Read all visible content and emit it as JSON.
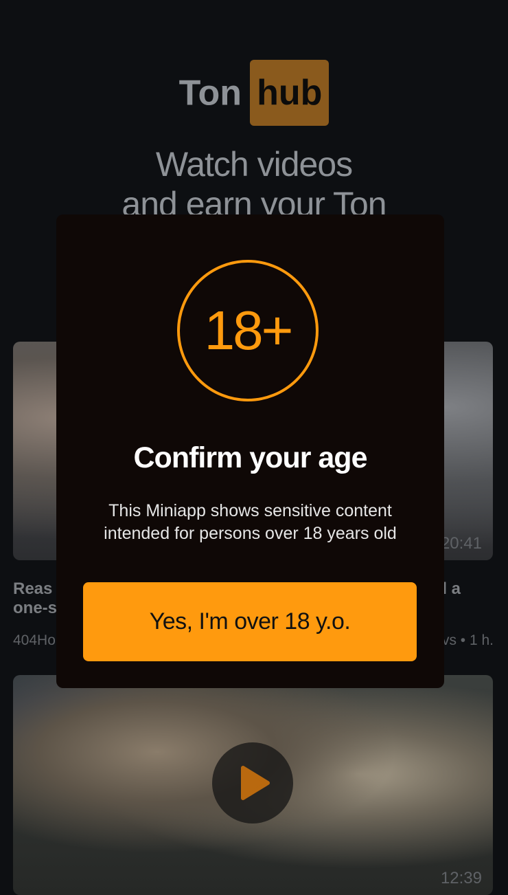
{
  "brand": {
    "logo_part1": "Ton",
    "logo_part2": "hub",
    "accent_color": "#ff9a0e"
  },
  "headline": {
    "line1": "Watch videos",
    "line2": "and earn your Ton"
  },
  "videos": [
    {
      "title_left_line1": "Reas",
      "title_left_line2": "one-s",
      "title_right": "l a",
      "meta_left": "404Ho",
      "meta_right": "vs • 1 h.",
      "duration": "20:41"
    },
    {
      "duration": "12:39",
      "play_icon": "play-icon"
    }
  ],
  "modal": {
    "age_badge": "18+",
    "title": "Confirm your age",
    "description": "This Miniapp shows sensitive content intended for persons over 18 years old",
    "confirm_label": "Yes, I'm over 18 y.o."
  }
}
